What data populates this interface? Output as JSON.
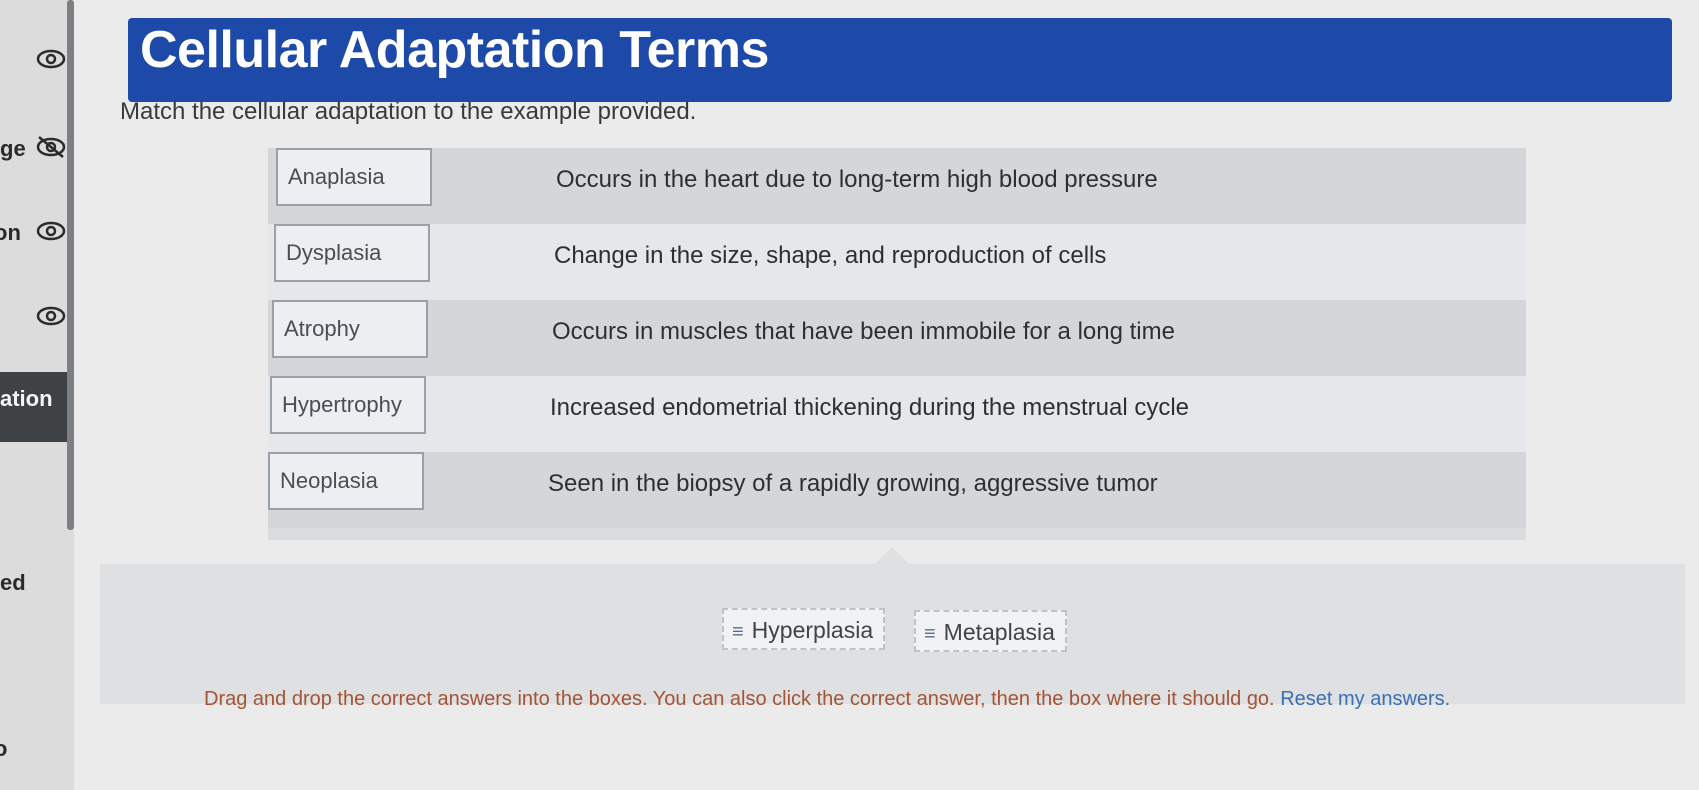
{
  "sidebar": {
    "labels": [
      "ge",
      "on",
      "ation",
      "ed",
      "o"
    ]
  },
  "header": {
    "title": "Cellular Adaptation Terms",
    "subtitle": "Match the cellular adaptation to the example provided."
  },
  "rows": [
    {
      "term": "Anaplasia",
      "example": "Occurs in the heart due to long-term high blood pressure"
    },
    {
      "term": "Dysplasia",
      "example": "Change in the size, shape, and reproduction of cells"
    },
    {
      "term": "Atrophy",
      "example": "Occurs in muscles that have been immobile for a long time"
    },
    {
      "term": "Hypertrophy",
      "example": "Increased endometrial thickening during the menstrual cycle"
    },
    {
      "term": "Neoplasia",
      "example": "Seen in the biopsy of a rapidly growing, aggressive tumor"
    }
  ],
  "bank": {
    "chips": [
      "Hyperplasia",
      "Metaplasia"
    ],
    "grip_icon": "≡"
  },
  "footer": {
    "instructions": "Drag and drop the correct answers into the boxes. You can also click the correct answer, then the box where it should go.",
    "reset_label": "Reset my answers."
  },
  "colors": {
    "title_bar": "#1d4aa8",
    "instructions": "#a35436",
    "reset_link": "#3a6fb5"
  }
}
